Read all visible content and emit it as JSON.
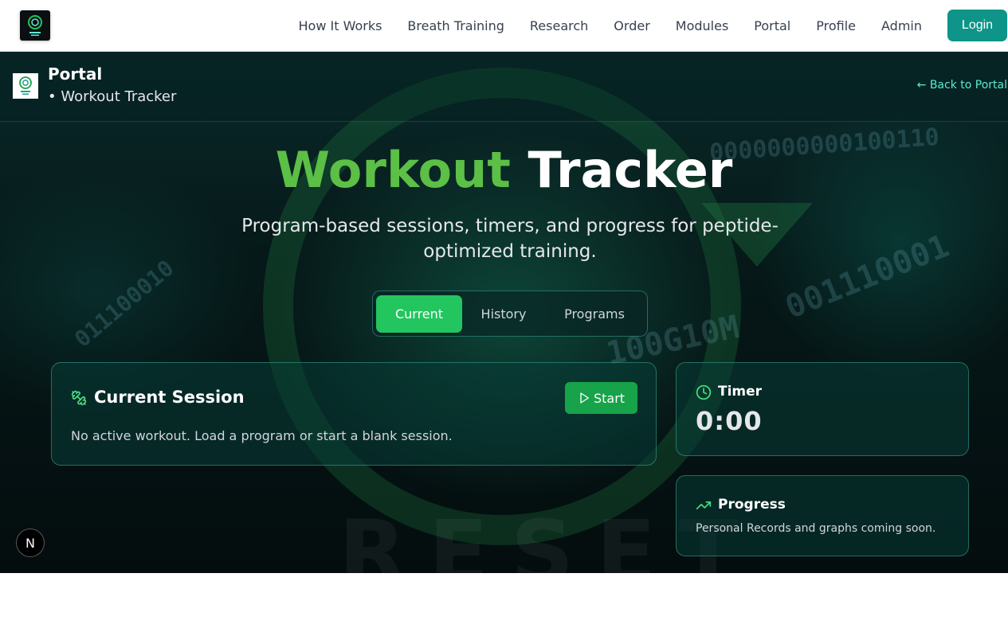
{
  "nav": {
    "logo_icon": "reset-logo-icon",
    "links": [
      "How It Works",
      "Breath Training",
      "Research",
      "Order",
      "Modules",
      "Portal",
      "Profile",
      "Admin"
    ],
    "login_label": "Login"
  },
  "subheader": {
    "title": "Portal",
    "subtitle": "• Workout Tracker",
    "back_label": "← Back to Portal"
  },
  "hero": {
    "title_part1": "Workout",
    "title_part2": "Tracker",
    "description": "Program-based sessions, timers, and progress for peptide-optimized training."
  },
  "tabs": [
    {
      "label": "Current",
      "active": true
    },
    {
      "label": "History",
      "active": false
    },
    {
      "label": "Programs",
      "active": false
    }
  ],
  "session_card": {
    "icon": "dumbbell-icon",
    "title": "Current Session",
    "start_label": "Start",
    "empty_text": "No active workout. Load a program or start a blank session."
  },
  "timer_card": {
    "icon": "clock-icon",
    "title": "Timer",
    "value": "0:00"
  },
  "progress_card": {
    "icon": "trending-up-icon",
    "title": "Progress",
    "text": "Personal Records and graphs coming soon."
  },
  "dev_badge": "N",
  "colors": {
    "accent_teal": "#0e9488",
    "accent_green": "#22c55e",
    "title_green": "#5cbf46",
    "link_teal": "#5eead4"
  }
}
